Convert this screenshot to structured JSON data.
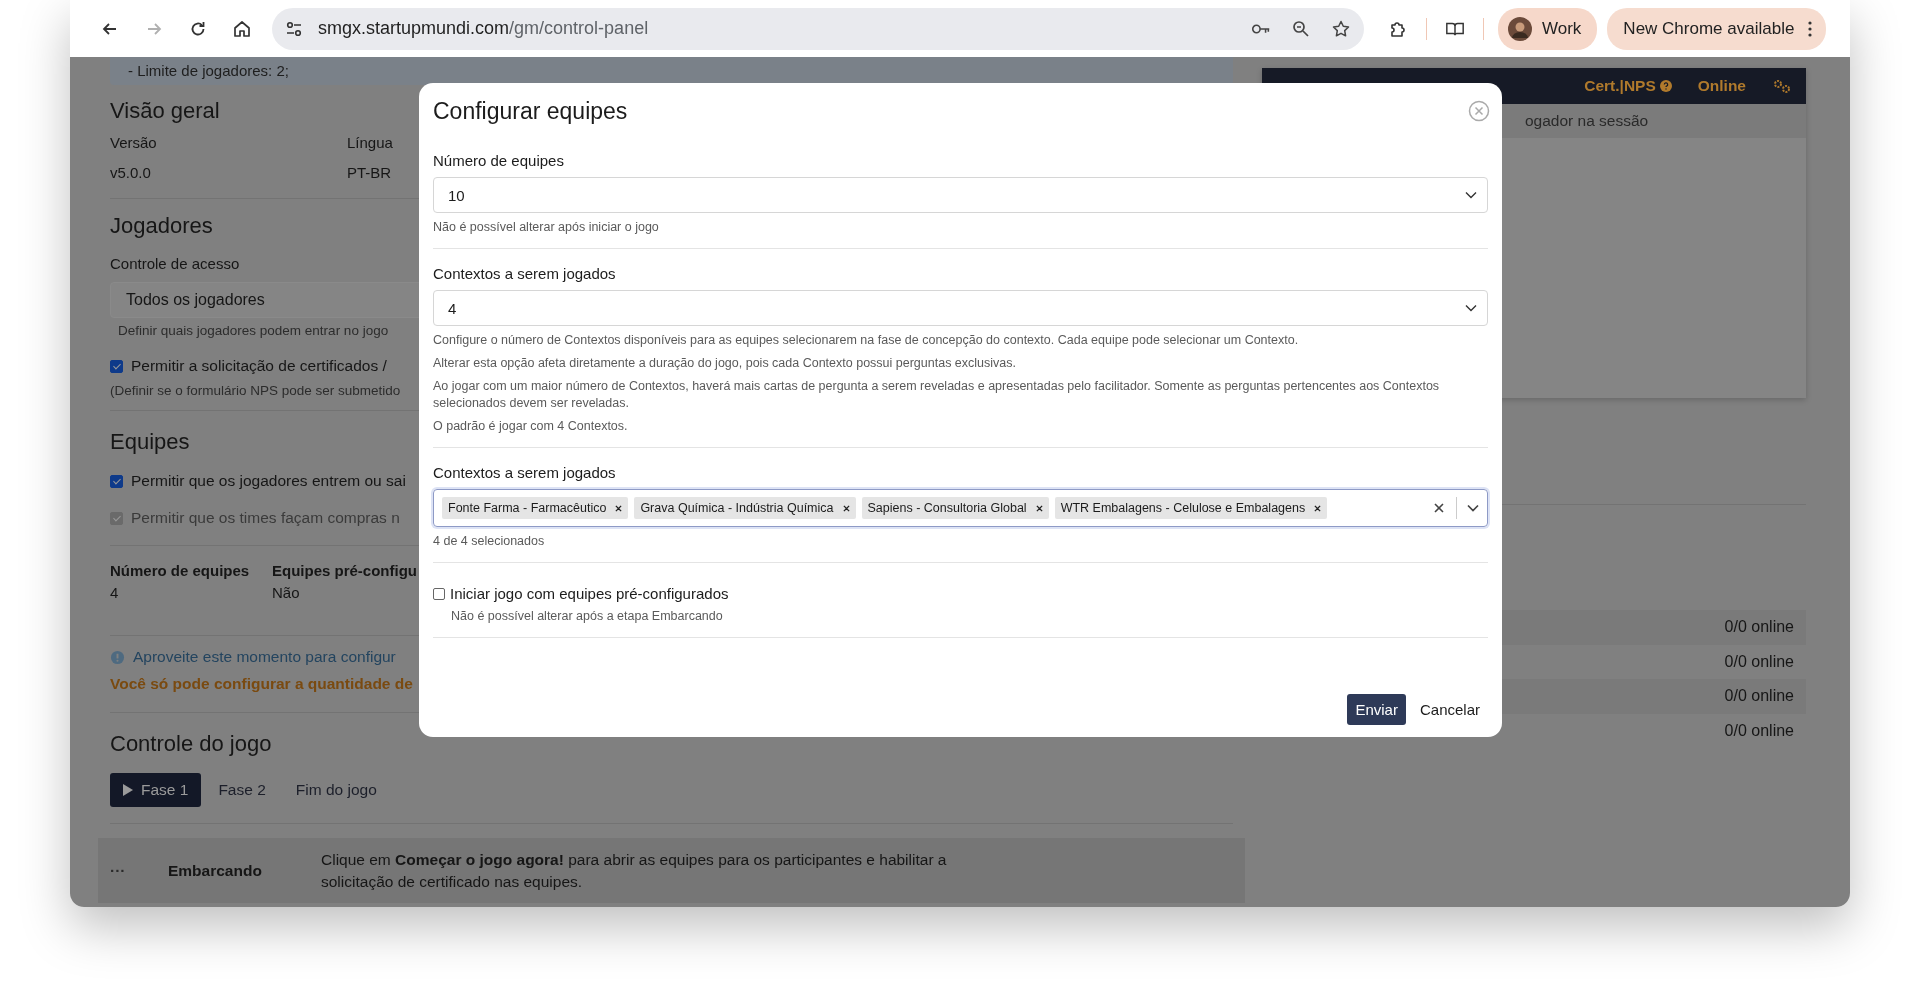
{
  "browser": {
    "url_host": "smgx.startupmundi.com",
    "url_path": "/gm/control-panel",
    "forward_disabled": true,
    "profile": "Work",
    "update_button": "New Chrome available"
  },
  "background": {
    "notice": "- Limite de jogadores: 2;",
    "overview": {
      "title": "Visão geral",
      "fields": [
        {
          "label": "Versão",
          "value": "v5.0.0"
        },
        {
          "label": "Língua",
          "value": "PT-BR"
        }
      ]
    },
    "players": {
      "title": "Jogadores",
      "access_label": "Controle de acesso",
      "access_value": "Todos os jogadores",
      "access_hint": "Definir quais jogadores podem entrar no jogo",
      "options": [
        {
          "label": "Permitir a solicitação de certificados /",
          "checked": true,
          "hint": "(Definir se o formulário NPS pode ser submetido"
        }
      ]
    },
    "teams": {
      "title": "Equipes",
      "options": [
        {
          "label": "Permitir que os jogadores entrem ou sai",
          "checked": true,
          "disabled": false
        },
        {
          "label": "Permitir que os times façam compras n",
          "checked": true,
          "disabled": true
        }
      ],
      "summary": [
        {
          "label": "Número de equipes",
          "value": "4"
        },
        {
          "label": "Equipes pré-configu",
          "value": "Não"
        }
      ],
      "info": "Aproveite este momento para configur",
      "warning": "Você só pode configurar a quantidade de"
    },
    "game_control": {
      "title": "Controle do jogo",
      "tabs": [
        {
          "label": "Fase 1",
          "selected": true
        },
        {
          "label": "Fase 2",
          "selected": false
        },
        {
          "label": "Fim do jogo",
          "selected": false
        }
      ]
    },
    "stage": {
      "menu": "···",
      "name": "Embarcando",
      "description": "Clique em **Começar o jogo agora!** para abrir as equipes para os participantes e habilitar a solicitação de certificado nas equipes."
    }
  },
  "side_panel": {
    "header": [
      {
        "label": "Cert.|NPS",
        "kind": "help"
      },
      {
        "label": "Online",
        "kind": "plain"
      },
      {
        "kind": "settings"
      }
    ],
    "session_text": "ogador na sessão",
    "rows": [
      {
        "status": "0/0 online"
      },
      {
        "status": "0/0 online"
      },
      {
        "status": "0/0 online"
      },
      {
        "status": "0/0 online"
      }
    ]
  },
  "modal": {
    "title": "Configurar equipes",
    "fields": [
      {
        "kind": "select",
        "label": "Número de equipes",
        "value": "10",
        "help": [
          "Não é possível alterar após iniciar o jogo"
        ]
      },
      {
        "kind": "select",
        "label": "Contextos a serem jogados",
        "value": "4",
        "help": [
          "Configure o número de Contextos disponíveis para as equipes selecionarem na fase de concepção do contexto. Cada equipe pode selecionar um Contexto.",
          "Alterar esta opção afeta diretamente a duração do jogo, pois cada Contexto possui perguntas exclusivas.",
          "Ao jogar com um maior número de Contextos, haverá mais cartas de pergunta a serem reveladas e apresentadas pelo facilitador. Somente as perguntas pertencentes aos Contextos selecionados devem ser reveladas.",
          "O padrão é jogar com 4 Contextos."
        ]
      },
      {
        "kind": "multiselect",
        "label": "Contextos a serem jogados",
        "tags": [
          "Fonte Farma - Farmacêutico",
          "Grava Química - Indústria Química",
          "Sapiens - Consultoria Global",
          "WTR Embalagens - Celulose e Embalagens"
        ],
        "help": [
          "4 de 4 selecionados"
        ]
      },
      {
        "kind": "checkbox",
        "label": "Iniciar jogo com equipes pré-configurados",
        "checked": false,
        "help": [
          "Não é possível alterar após a etapa Embarcando"
        ]
      }
    ],
    "buttons": [
      {
        "label": "Enviar",
        "kind": "primary"
      },
      {
        "label": "Cancelar",
        "kind": "plain"
      }
    ]
  }
}
